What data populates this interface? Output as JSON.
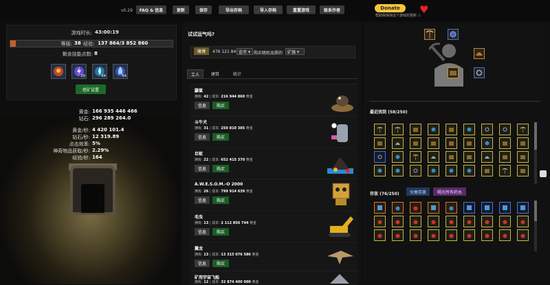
{
  "topbar": {
    "version": "v0.29",
    "buttons": [
      "FAQ & 信息",
      "更新",
      "保存",
      "导出存档",
      "导入存档",
      "重置游戏",
      "联系作者"
    ],
    "donate_label": "Donate",
    "donate_text": "帮助我保持这个游戏的更新 :)"
  },
  "stats": {
    "playtime_label": "游戏时长:",
    "playtime": "43:00:19",
    "level_label": "等级:",
    "level": "38",
    "xp_label": "经验:",
    "xp": "137 864/3 852 860",
    "xp_progress": 0.036,
    "skill_points_label": "剩余技能点数:",
    "skill_points": "8",
    "skills": [
      {
        "icon": "fire-fist-icon",
        "count": "64",
        "color": "#c0462a"
      },
      {
        "icon": "lightning-orb-icon",
        "count": "29",
        "color": "#6a4ad0"
      },
      {
        "icon": "water-drop-icon",
        "count": "64",
        "color": "#2a7a9a"
      },
      {
        "icon": "blue-flame-icon",
        "count": "64",
        "color": "#3a52b8"
      }
    ],
    "dig_button": "挖矿设置"
  },
  "resources": {
    "gold_label": "黄金:",
    "gold": "166 935 446 466",
    "diamond_label": "钻石:",
    "diamond": "296 289 264.0",
    "gold_rate_label": "黄金/秒:",
    "gold_rate": "4 420 101.4",
    "diamond_rate_label": "钻石/秒:",
    "diamond_rate": "12 319.89",
    "click_label": "点击效率:",
    "click": "5%",
    "artifact_label": "神奇物品获取/秒:",
    "artifact": "2.29%",
    "xp_rate_label": "经验/秒:",
    "xp_rate": "164"
  },
  "gamble": {
    "title": "试试运气吗?",
    "button": "赌博",
    "amount": "476 121 849",
    "currency_select": "金币",
    "text": "购买随机品质的",
    "item_select": "矿镐"
  },
  "tabs": [
    "工人",
    "建筑",
    "统计"
  ],
  "workers": [
    {
      "name": "鼹鼠",
      "owned_label": "拥有:",
      "owned": "42",
      "cost_label": "| 成本:",
      "cost": "216 944 860",
      "unit": "黄金"
    },
    {
      "name": "斗牛犬",
      "owned_label": "拥有:",
      "owned": "31",
      "cost_label": "| 成本:",
      "cost": "250 810 385",
      "unit": "黄金"
    },
    {
      "name": "巨蚁",
      "owned_label": "拥有:",
      "owned": "22",
      "cost_label": "| 成本:",
      "cost": "652 415 370",
      "unit": "黄金"
    },
    {
      "name": "A.W.E.S.O.M.-O 2000",
      "owned_label": "拥有:",
      "owned": "26",
      "cost_label": "| 成本:",
      "cost": "799 914 639",
      "unit": "黄金"
    },
    {
      "name": "毛虫",
      "owned_label": "拥有:",
      "owned": "13",
      "cost_label": "| 成本:",
      "cost": "2 112 856 744",
      "unit": "黄金"
    },
    {
      "name": "翼龙",
      "owned_label": "拥有:",
      "owned": "13",
      "cost_label": "| 成本:",
      "cost": "13 315 076 586",
      "unit": "黄金"
    },
    {
      "name": "矿用宇宙飞船",
      "owned_label": "拥有:",
      "owned": "12",
      "cost_label": "| 成本:",
      "cost": "32 874 400 000",
      "unit": "黄金"
    }
  ],
  "worker_info_label": "信息",
  "worker_buy_label": "购买",
  "recent": {
    "title": "最近找到 (58/250)"
  },
  "storage": {
    "title": "存放 (76/250)",
    "sort_label": "分类存放",
    "sell_label": "喝光所有药水"
  },
  "colors": {
    "accent": "#1c5c27",
    "gold": "#f5c43c",
    "heart": "#e3232a"
  }
}
